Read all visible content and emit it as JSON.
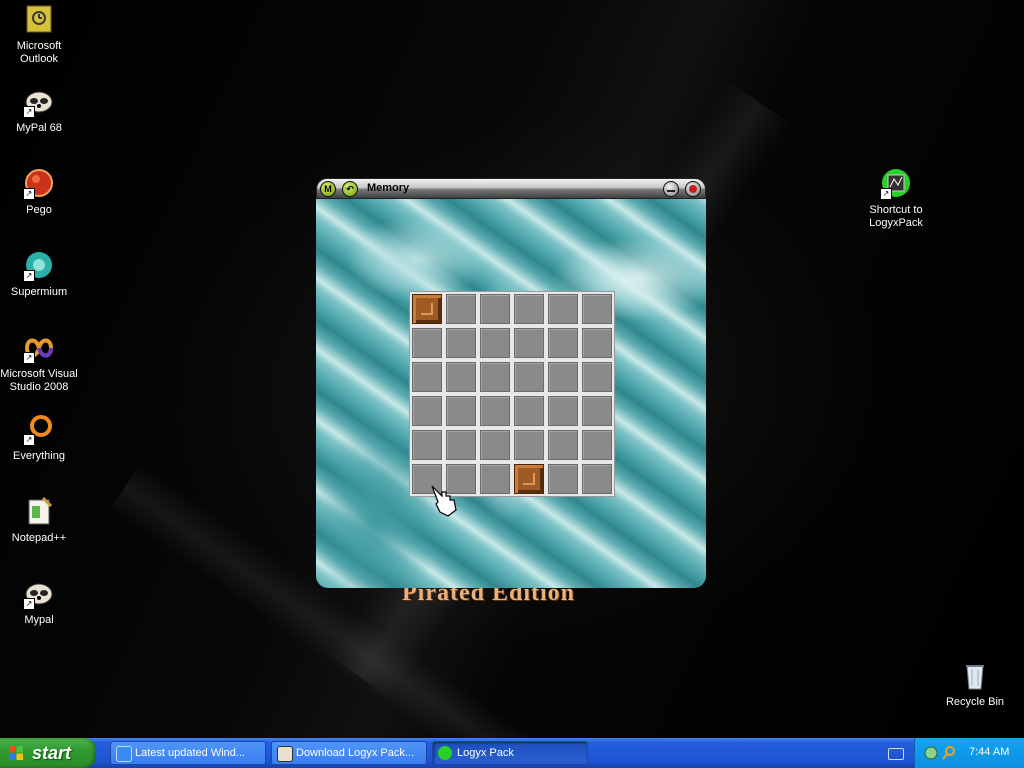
{
  "desktop": {
    "icons_left": [
      {
        "label": "Microsoft Outlook",
        "icon": "outlook-icon"
      },
      {
        "label": "MyPal 68",
        "icon": "mypal-icon"
      },
      {
        "label": "Pego",
        "icon": "pego-icon"
      },
      {
        "label": "Supermium",
        "icon": "supermium-icon"
      },
      {
        "label": "Microsoft Visual Studio 2008",
        "icon": "visual-studio-icon"
      },
      {
        "label": "Everything",
        "icon": "everything-icon"
      },
      {
        "label": "Notepad++",
        "icon": "notepadpp-icon"
      },
      {
        "label": "Mypal",
        "icon": "mypal-icon"
      }
    ],
    "icon_shortcut": {
      "label": "Shortcut to LogyxPack",
      "icon": "logyxpack-icon"
    },
    "icon_recycle": {
      "label": "Recycle Bin",
      "icon": "recycle-bin-icon"
    },
    "wallpaper_text": "Pirated Edition"
  },
  "window": {
    "title": "Memory",
    "left_buttons": [
      "M",
      "↶"
    ],
    "right_buttons": [
      "minimize",
      "close"
    ],
    "grid": {
      "rows": 6,
      "cols": 6,
      "revealed": [
        [
          0,
          0
        ],
        [
          5,
          3
        ]
      ],
      "hidden_color": "#8a8a8a",
      "revealed_color": "#a05a24"
    }
  },
  "taskbar": {
    "start_label": "start",
    "tasks": [
      {
        "label": "Latest updated Wind...",
        "active": false,
        "icon": "ie-icon"
      },
      {
        "label": "Download Logyx Pack...",
        "active": false,
        "icon": "mypal-icon"
      },
      {
        "label": "Logyx Pack",
        "active": true,
        "icon": "logyx-icon"
      }
    ],
    "clock": "7:44 AM"
  }
}
